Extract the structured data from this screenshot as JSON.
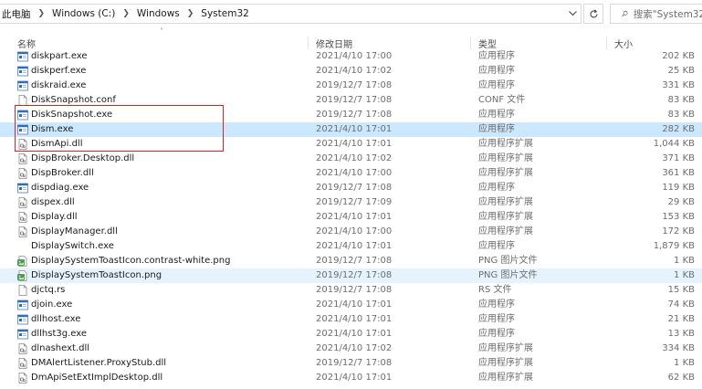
{
  "address": {
    "crumbs": [
      "此电脑",
      "Windows (C:)",
      "Windows",
      "System32"
    ]
  },
  "search": {
    "placeholder": "搜索\"System32\""
  },
  "columns": {
    "name": "名称",
    "date": "修改日期",
    "type": "类型",
    "size": "大小"
  },
  "colors": {
    "selected_bg": "#cce8ff",
    "hover_bg": "#e5f3ff",
    "highlight_border": "#e02020"
  },
  "files": [
    {
      "name": "diskpart.exe",
      "date": "2021/4/10 17:00",
      "type": "应用程序",
      "size": "202 KB",
      "icon": "exe"
    },
    {
      "name": "diskperf.exe",
      "date": "2021/4/10 17:02",
      "type": "应用程序",
      "size": "25 KB",
      "icon": "exe"
    },
    {
      "name": "diskraid.exe",
      "date": "2019/12/7 17:08",
      "type": "应用程序",
      "size": "331 KB",
      "icon": "exe"
    },
    {
      "name": "DiskSnapshot.conf",
      "date": "2019/12/7 17:08",
      "type": "CONF 文件",
      "size": "83 KB",
      "icon": "file"
    },
    {
      "name": "DiskSnapshot.exe",
      "date": "2019/12/7 17:08",
      "type": "应用程序",
      "size": "83 KB",
      "icon": "exe"
    },
    {
      "name": "Dism.exe",
      "date": "2021/4/10 17:01",
      "type": "应用程序",
      "size": "282 KB",
      "icon": "exe",
      "state": "selected"
    },
    {
      "name": "DismApi.dll",
      "date": "2021/4/10 17:01",
      "type": "应用程序扩展",
      "size": "1,044 KB",
      "icon": "dll"
    },
    {
      "name": "DispBroker.Desktop.dll",
      "date": "2021/4/10 17:02",
      "type": "应用程序扩展",
      "size": "371 KB",
      "icon": "dll"
    },
    {
      "name": "DispBroker.dll",
      "date": "2021/4/10 17:00",
      "type": "应用程序扩展",
      "size": "361 KB",
      "icon": "dll"
    },
    {
      "name": "dispdiag.exe",
      "date": "2019/12/7 17:08",
      "type": "应用程序",
      "size": "119 KB",
      "icon": "exe"
    },
    {
      "name": "dispex.dll",
      "date": "2019/12/7 17:09",
      "type": "应用程序扩展",
      "size": "29 KB",
      "icon": "dll"
    },
    {
      "name": "Display.dll",
      "date": "2021/4/10 17:01",
      "type": "应用程序扩展",
      "size": "153 KB",
      "icon": "dll"
    },
    {
      "name": "DisplayManager.dll",
      "date": "2021/4/10 17:00",
      "type": "应用程序扩展",
      "size": "172 KB",
      "icon": "dll"
    },
    {
      "name": "DisplaySwitch.exe",
      "date": "2021/4/10 17:01",
      "type": "应用程序",
      "size": "1,879 KB",
      "icon": "none"
    },
    {
      "name": "DisplaySystemToastIcon.contrast-white.png",
      "date": "2019/12/7 17:08",
      "type": "PNG 图片文件",
      "size": "1 KB",
      "icon": "png"
    },
    {
      "name": "DisplaySystemToastIcon.png",
      "date": "2019/12/7 17:08",
      "type": "PNG 图片文件",
      "size": "1 KB",
      "icon": "png",
      "state": "hover"
    },
    {
      "name": "djctq.rs",
      "date": "2019/12/7 17:08",
      "type": "RS 文件",
      "size": "15 KB",
      "icon": "file"
    },
    {
      "name": "djoin.exe",
      "date": "2021/4/10 17:01",
      "type": "应用程序",
      "size": "74 KB",
      "icon": "exe"
    },
    {
      "name": "dllhost.exe",
      "date": "2021/4/10 17:01",
      "type": "应用程序",
      "size": "21 KB",
      "icon": "exe"
    },
    {
      "name": "dllhst3g.exe",
      "date": "2021/4/10 17:01",
      "type": "应用程序",
      "size": "13 KB",
      "icon": "exe"
    },
    {
      "name": "dlnashext.dll",
      "date": "2021/4/10 17:02",
      "type": "应用程序扩展",
      "size": "334 KB",
      "icon": "dll"
    },
    {
      "name": "DMAlertListener.ProxyStub.dll",
      "date": "2019/12/7 17:08",
      "type": "应用程序扩展",
      "size": "1 KB",
      "icon": "dll"
    },
    {
      "name": "DmApiSetExtImplDesktop.dll",
      "date": "2021/4/10 17:01",
      "type": "应用程序扩展",
      "size": "62 KB",
      "icon": "dll"
    }
  ]
}
